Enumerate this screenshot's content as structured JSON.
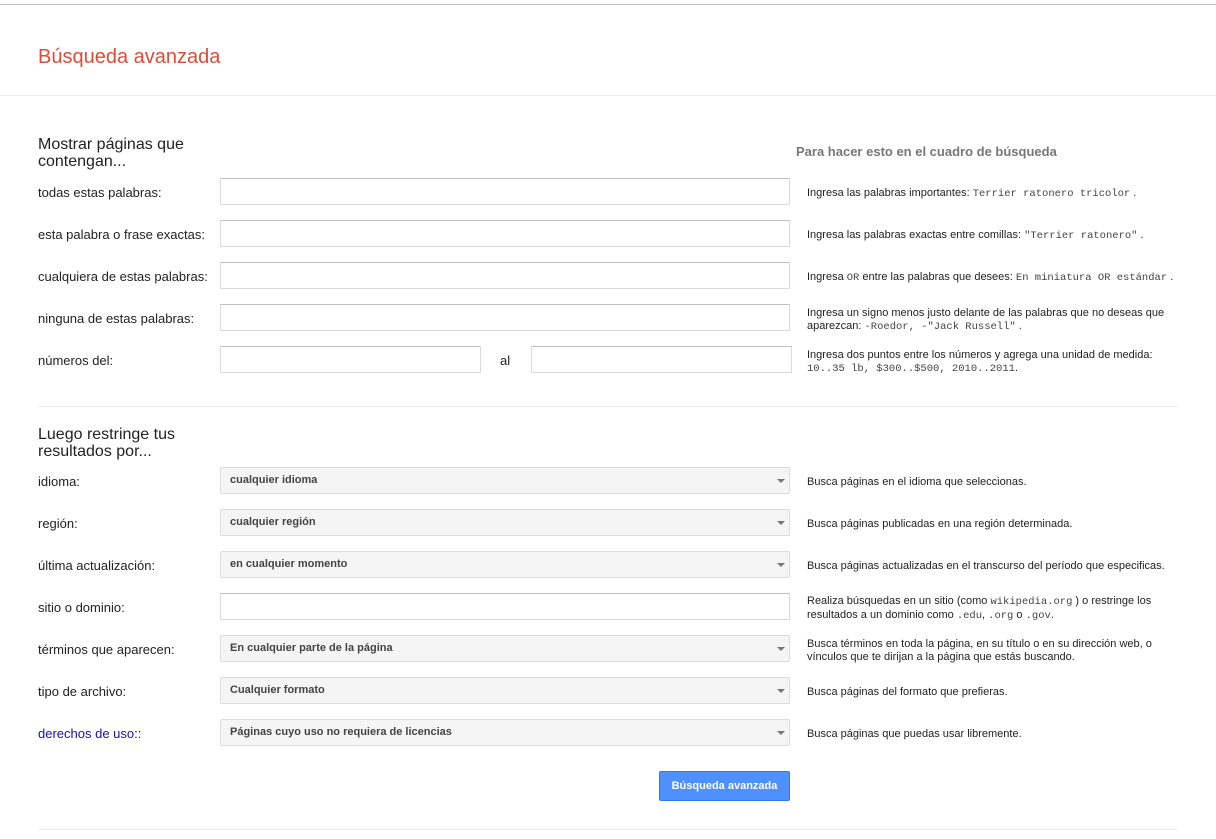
{
  "header": {
    "title": "Búsqueda avanzada"
  },
  "section1": {
    "title": "Mostrar páginas que contengan...",
    "right_header": "Para hacer esto en el cuadro de búsqueda",
    "rows": {
      "all_words": {
        "label": "todas estas palabras:",
        "value": "",
        "hint_a": "Ingresa las palabras importantes: ",
        "hint_code": "Terrier ratonero tricolor",
        "hint_b": " ."
      },
      "exact": {
        "label": "esta palabra o frase exactas:",
        "value": "",
        "hint_a": "Ingresa las palabras exactas entre comillas: ",
        "hint_code": "\"Terrier ratonero\"",
        "hint_b": " ."
      },
      "any": {
        "label": "cualquiera de estas palabras:",
        "value": "",
        "hint_a": "Ingresa ",
        "hint_code1": "OR",
        "hint_b": " entre las palabras que desees: ",
        "hint_code2": "En miniatura OR estándar",
        "hint_c": " ."
      },
      "none": {
        "label": "ninguna de estas palabras:",
        "value": "",
        "hint_a": "Ingresa un signo menos justo delante de las palabras que no deseas que aparezcan: ",
        "hint_code": "-Roedor, -\"Jack Russell\"",
        "hint_b": " ."
      },
      "numbers": {
        "label": "números del:",
        "from": "",
        "to_label": "al",
        "to": "",
        "hint_a": "Ingresa dos puntos entre los números y agrega una unidad de medida: ",
        "hint_code": "10..35 lb, $300..$500, 2010..2011",
        "hint_b": "."
      }
    }
  },
  "section2": {
    "title": "Luego restringe tus resultados por...",
    "rows": {
      "language": {
        "label": "idioma:",
        "selected": "cualquier idioma",
        "hint": "Busca páginas en el idioma que seleccionas."
      },
      "region": {
        "label": "región:",
        "selected": "cualquier región",
        "hint": "Busca páginas publicadas en una región determinada."
      },
      "updated": {
        "label": "última actualización:",
        "selected": "en cualquier momento",
        "hint": "Busca páginas actualizadas en el transcurso del período que especificas."
      },
      "site": {
        "label": "sitio o dominio:",
        "value": "",
        "hint_a": "Realiza búsquedas en un sitio (como ",
        "hint_code1": "wikipedia.org",
        "hint_b": " ) o restringe los resultados a un dominio como ",
        "hint_code2": ".edu",
        "hint_c": ", ",
        "hint_code3": ".org",
        "hint_d": " o ",
        "hint_code4": ".gov",
        "hint_e": "."
      },
      "terms": {
        "label": "términos que aparecen:",
        "selected": "En cualquier parte de la página",
        "hint": "Busca términos en toda la página, en su título o en su dirección web, o vínculos que te dirijan a la página que estás buscando."
      },
      "filetype": {
        "label": "tipo de archivo:",
        "selected": "Cualquier formato",
        "hint": "Busca páginas del formato que prefieras."
      },
      "rights": {
        "label": "derechos de uso::",
        "selected": "Páginas cuyo uso no requiera de licencias",
        "hint": "Busca páginas que puedas usar libremente."
      }
    }
  },
  "submit": {
    "label": "Búsqueda avanzada",
    "color": "#4d90fe"
  },
  "colors": {
    "title": "#dd4b39",
    "link": "#1a0dab"
  }
}
